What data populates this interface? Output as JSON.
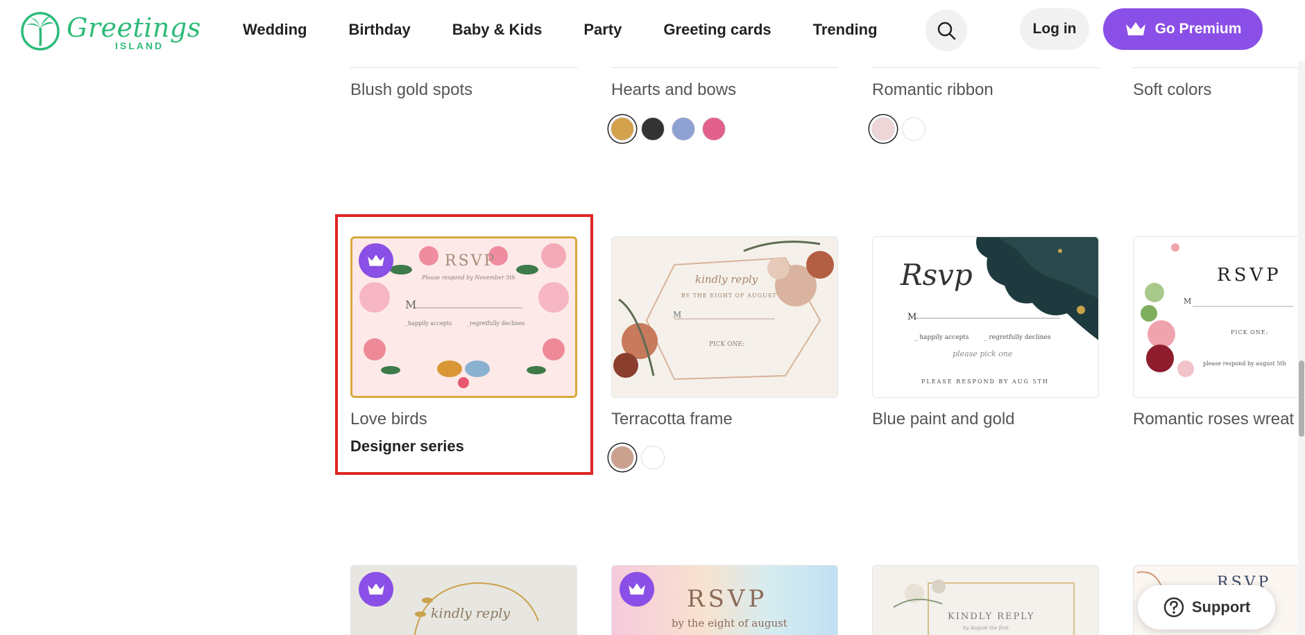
{
  "brand": {
    "name": "Greetings",
    "sub": "ISLAND",
    "color": "#2dbb78"
  },
  "nav": {
    "items": [
      "Wedding",
      "Birthday",
      "Baby & Kids",
      "Party",
      "Greeting cards",
      "Trending"
    ]
  },
  "header": {
    "login_label": "Log in",
    "premium_label": "Go Premium",
    "accent": "#8a4fe6"
  },
  "row1": [
    {
      "title": "Blush gold spots"
    },
    {
      "title": "Hearts and bows",
      "swatches": [
        "#d4a24c",
        "#333333",
        "#8fa0d2",
        "#e2608c"
      ]
    },
    {
      "title": "Romantic ribbon",
      "swatches": [
        "#eed5d8",
        "#ffffff"
      ]
    },
    {
      "title": "Soft colors"
    }
  ],
  "row2": [
    {
      "title": "Love birds",
      "subtitle": "Designer series",
      "premium": true,
      "art": {
        "heading": "RSVP",
        "line1": "Please respond by November 5th",
        "m": "M",
        "opt1": "_happily accepts",
        "opt2": "_regretfully declines"
      }
    },
    {
      "title": "Terracotta frame",
      "swatches": [
        "#c9a18d",
        "#ffffff"
      ],
      "art": {
        "heading": "kindly reply",
        "line1": "BY THE EIGHT OF AUGUST",
        "m": "M",
        "pick": "PICK ONE:"
      }
    },
    {
      "title": "Blue paint and gold",
      "art": {
        "heading": "Rsvp",
        "m": "M",
        "opt1": "_ happily accepts",
        "opt2": "_ regretfully declines",
        "pick": "please pick one",
        "footer": "PLEASE RESPOND BY AUG 5TH"
      }
    },
    {
      "title": "Romantic roses wreat",
      "art": {
        "heading": "RSVP",
        "m": "M",
        "pick": "PICK ONE:",
        "footer": "please respond by august 5th"
      }
    }
  ],
  "row3": [
    {
      "premium": true,
      "art": {
        "heading": "kindly reply"
      }
    },
    {
      "premium": true,
      "art": {
        "heading": "RSVP",
        "line1": "by the eight of august"
      }
    },
    {
      "art": {
        "heading": "KINDLY REPLY",
        "line1": "by August the first"
      }
    },
    {
      "art": {
        "heading": "RSVP"
      }
    }
  ],
  "support": {
    "label": "Support"
  }
}
